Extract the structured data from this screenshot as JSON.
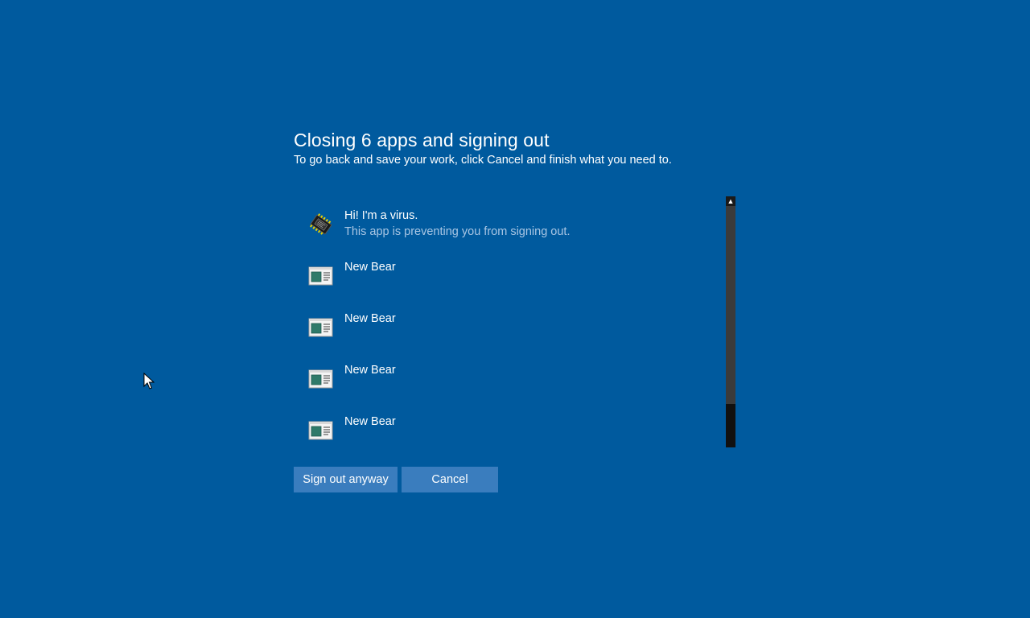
{
  "dialog": {
    "title": "Closing 6 apps and signing out",
    "subtitle": "To go back and save your work, click Cancel and finish what you need to."
  },
  "apps": [
    {
      "name": "Hi! I'm a virus.",
      "status": "This app is preventing you from signing out.",
      "icon": "virus-chip-icon"
    },
    {
      "name": "New Bear",
      "status": "",
      "icon": "window-app-icon"
    },
    {
      "name": "New Bear",
      "status": "",
      "icon": "window-app-icon"
    },
    {
      "name": "New Bear",
      "status": "",
      "icon": "window-app-icon"
    },
    {
      "name": "New Bear",
      "status": "",
      "icon": "window-app-icon"
    }
  ],
  "buttons": {
    "sign_out_label": "Sign out anyway",
    "cancel_label": "Cancel"
  },
  "colors": {
    "background": "#005a9e",
    "button": "#3a7dbe",
    "status_text": "#a9c6e4"
  }
}
